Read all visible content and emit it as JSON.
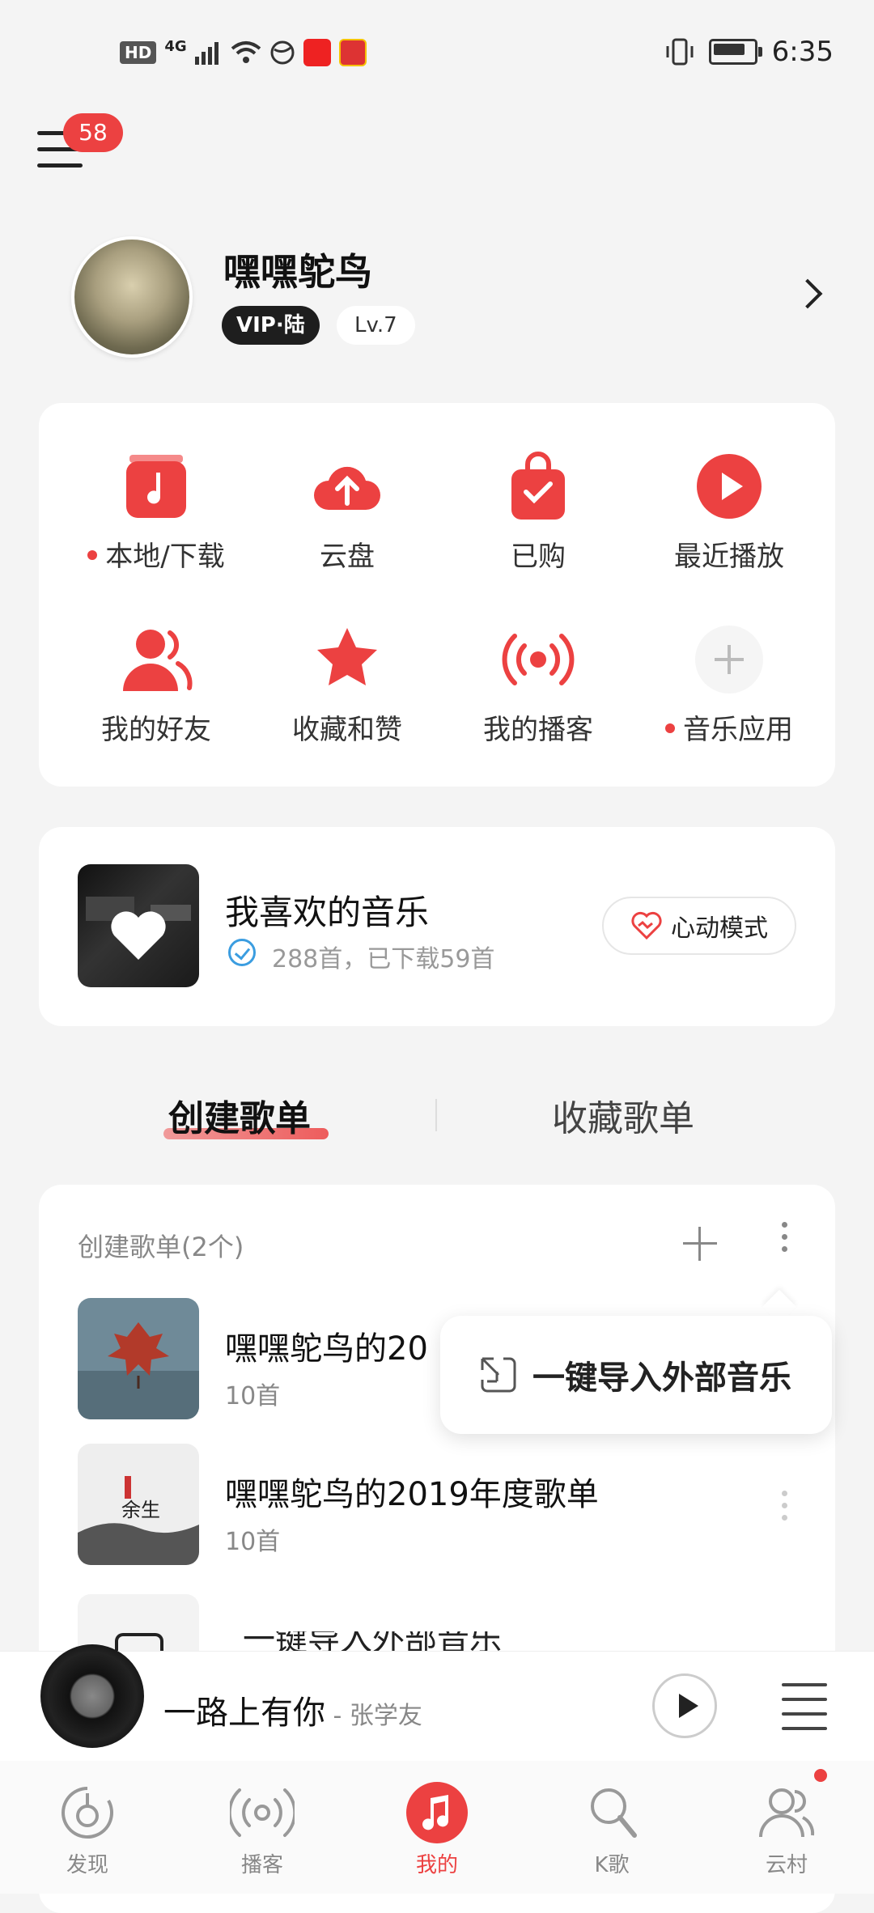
{
  "status_bar": {
    "badge": "HD",
    "network": "4G",
    "time": "6:35"
  },
  "header": {
    "notif_count": "58"
  },
  "profile": {
    "name": "嘿嘿鸵鸟",
    "vip": "VIP·陆",
    "level": "Lv.7"
  },
  "grid": [
    {
      "label": "本地/下载",
      "icon": "music-note-icon",
      "dot": true
    },
    {
      "label": "云盘",
      "icon": "cloud-upload-icon",
      "dot": false
    },
    {
      "label": "已购",
      "icon": "shopping-bag-icon",
      "dot": false
    },
    {
      "label": "最近播放",
      "icon": "play-circle-icon",
      "dot": false
    },
    {
      "label": "我的好友",
      "icon": "friends-icon",
      "dot": false
    },
    {
      "label": "收藏和赞",
      "icon": "star-icon",
      "dot": false
    },
    {
      "label": "我的播客",
      "icon": "broadcast-icon",
      "dot": false
    },
    {
      "label": "音乐应用",
      "icon": "plus-icon",
      "dot": true
    }
  ],
  "favorite": {
    "title": "我喜欢的音乐",
    "sub": "288首，已下载59首",
    "mode_button": "心动模式"
  },
  "tabs": {
    "created": "创建歌单",
    "collected": "收藏歌单"
  },
  "playlists": {
    "header": "创建歌单(2个)",
    "items": [
      {
        "title": "嘿嘿鸵鸟的20",
        "count": "10首"
      },
      {
        "title": "嘿嘿鸵鸟的2019年度歌单",
        "count": "10首"
      }
    ],
    "cover2_text": "余生",
    "popup": "一键导入外部音乐",
    "peek_text": "一键导入外部音乐"
  },
  "player": {
    "song": "一路上有你",
    "artist": " - 张学友"
  },
  "nav": [
    {
      "label": "发现",
      "icon": "discover-icon"
    },
    {
      "label": "播客",
      "icon": "podcast-icon"
    },
    {
      "label": "我的",
      "icon": "music-icon",
      "active": true
    },
    {
      "label": "K歌",
      "icon": "microphone-icon"
    },
    {
      "label": "云村",
      "icon": "community-icon"
    }
  ],
  "colors": {
    "accent": "#ec4141",
    "background": "#f4f4f4"
  }
}
